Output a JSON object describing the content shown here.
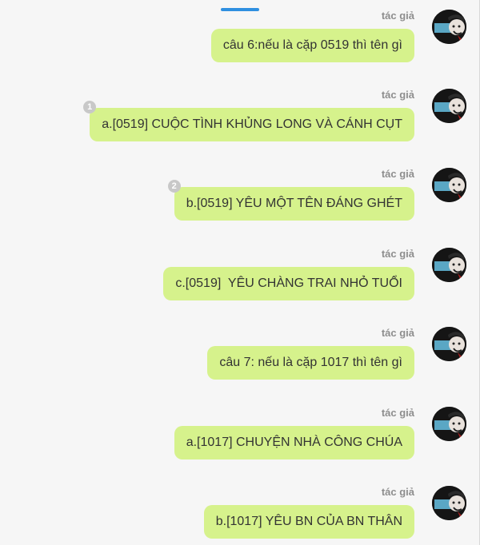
{
  "author_label": "tác giả",
  "messages": [
    {
      "text": "câu 6:nếu là cặp 0519 thì tên gì",
      "badge": ""
    },
    {
      "text": "a.[0519] CUỘC TÌNH KHỦNG LONG VÀ CÁNH CỤT",
      "badge": "1"
    },
    {
      "text": "b.[0519] YÊU MỘT TÊN ĐÁNG GHÉT",
      "badge": "2"
    },
    {
      "text": "c.[0519]  YÊU CHÀNG TRAI NHỎ TUỔI",
      "badge": ""
    },
    {
      "text": "câu 7: nếu là cặp 1017 thì tên gì",
      "badge": ""
    },
    {
      "text": "a.[1017] CHUYỆN NHÀ CÔNG CHÚA",
      "badge": ""
    },
    {
      "text": "b.[1017] YÊU BN CỦA BN THÂN",
      "badge": ""
    }
  ],
  "colors": {
    "bubble": "#d6f28c",
    "background": "#f6f6f6",
    "accent": "#2f8fe0",
    "author_text": "#8e8e8e"
  },
  "icons": {
    "avatar": "user-avatar-icon",
    "badge": "reaction-count-badge"
  }
}
